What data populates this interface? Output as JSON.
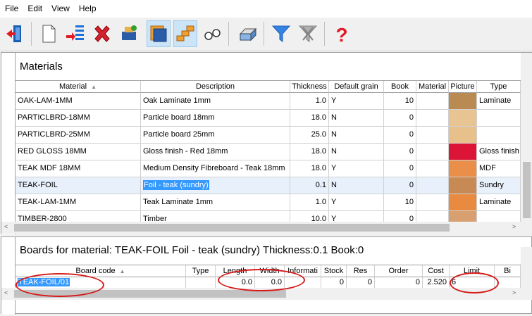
{
  "menu": [
    "File",
    "Edit",
    "View",
    "Help"
  ],
  "toolbar": {
    "icons": [
      "exit-icon",
      "new-page-icon",
      "list-import-icon",
      "delete-icon",
      "print-board-icon",
      "stack-icon",
      "steps-icon",
      "glasses-icon",
      "printer-icon",
      "filter-icon",
      "clear-filter-icon",
      "help-icon"
    ]
  },
  "materials": {
    "title": "Materials",
    "headers": [
      "Material",
      "Description",
      "Thickness",
      "Default grain",
      "Book",
      "Material",
      "Picture",
      "Type"
    ],
    "rows": [
      {
        "material": "OAK-LAM-1MM",
        "description": "Oak Laminate 1mm",
        "thickness": "1.0",
        "grain": "Y",
        "book": "10",
        "type": "Laminate",
        "color": "#b98a52"
      },
      {
        "material": "PARTICLBRD-18MM",
        "description": "Particle board 18mm",
        "thickness": "18.0",
        "grain": "N",
        "book": "0",
        "type": "",
        "color": "#e9c493"
      },
      {
        "material": "PARTICLBRD-25MM",
        "description": "Particle board 25mm",
        "thickness": "25.0",
        "grain": "N",
        "book": "0",
        "type": "",
        "color": "#e7c08c"
      },
      {
        "material": "RED GLOSS 18MM",
        "description": "Gloss finish - Red 18mm",
        "thickness": "18.0",
        "grain": "N",
        "book": "0",
        "type": "Gloss finish",
        "color": "#dc1436"
      },
      {
        "material": "TEAK MDF 18MM",
        "description": "Medium Density Fibreboard - Teak 18mm",
        "thickness": "18.0",
        "grain": "Y",
        "book": "0",
        "type": "MDF",
        "color": "#e98f4a"
      },
      {
        "material": "TEAK-FOIL",
        "description": "Foil - teak (sundry)",
        "thickness": "0.1",
        "grain": "N",
        "book": "0",
        "type": "Sundry",
        "color": "#c78a55"
      },
      {
        "material": "TEAK-LAM-1MM",
        "description": "Teak Laminate 1mm",
        "thickness": "1.0",
        "grain": "Y",
        "book": "10",
        "type": "Laminate",
        "color": "#e88a40"
      },
      {
        "material": "TIMBER-2800",
        "description": "Timber",
        "thickness": "10.0",
        "grain": "Y",
        "book": "0",
        "type": "",
        "color": "#d8a070"
      }
    ]
  },
  "boards": {
    "title": "Boards for material: TEAK-FOIL Foil - teak (sundry) Thickness:0.1 Book:0",
    "headers": [
      "Board code",
      "Type",
      "Length",
      "Width",
      "Informati",
      "Stock",
      "Res",
      "Order",
      "Cost",
      "Limit",
      "Bi"
    ],
    "row": {
      "code": "TEAK-FOIL/01",
      "type": "",
      "length": "0.0",
      "width": "0.0",
      "info": "",
      "stock": "0",
      "res": "0",
      "order": "0",
      "cost": "2.520",
      "limit": "6"
    }
  }
}
